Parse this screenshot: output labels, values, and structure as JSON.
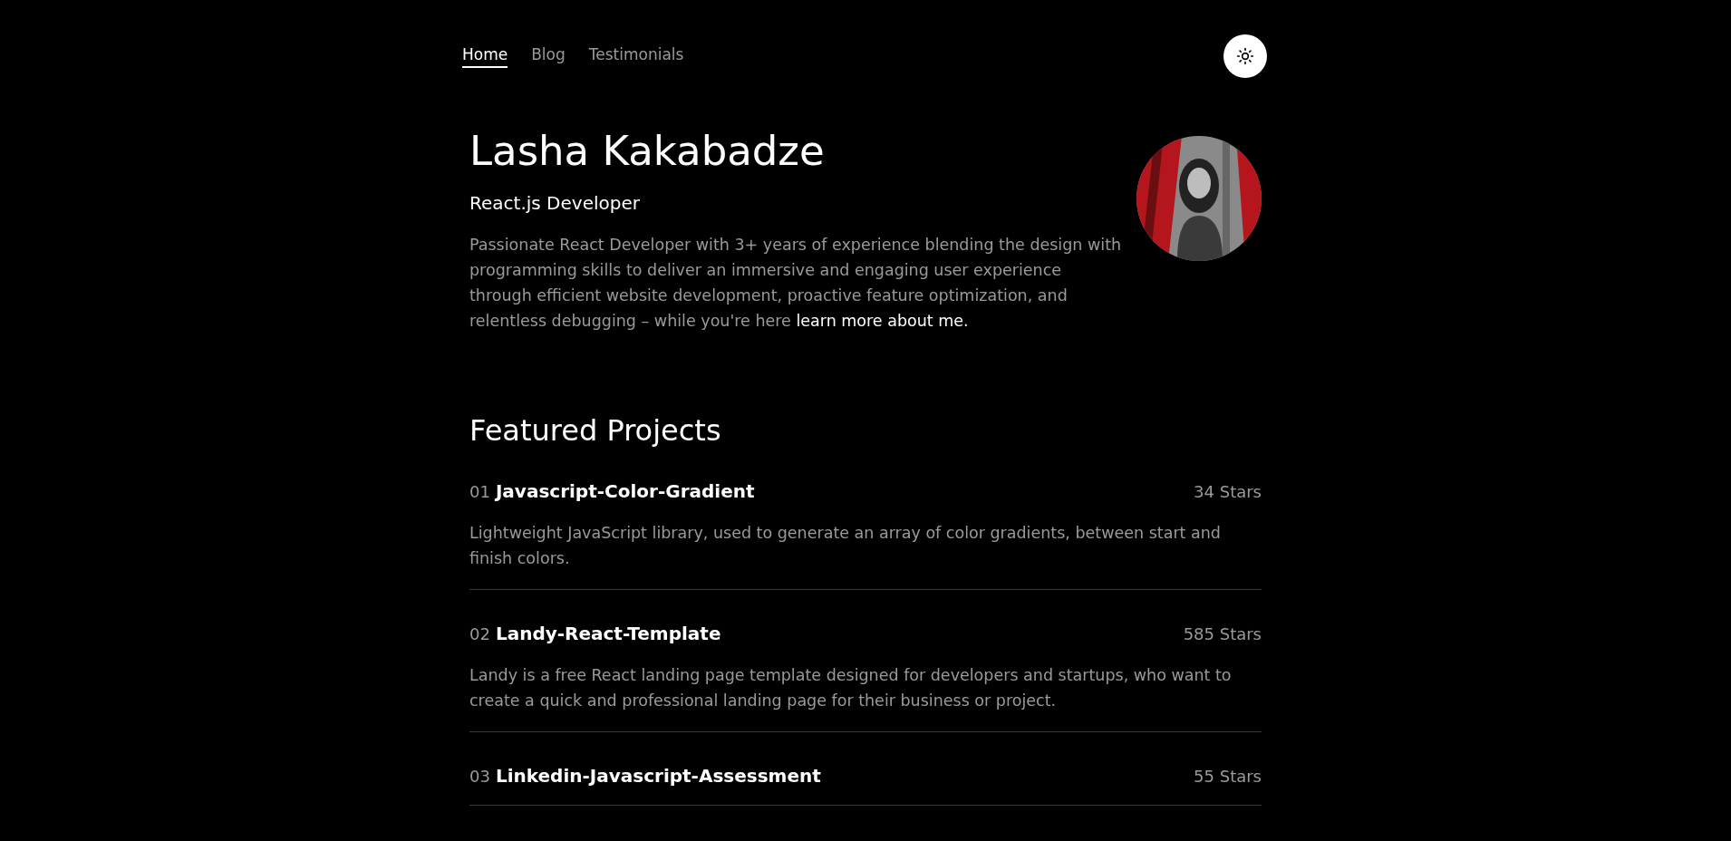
{
  "nav": {
    "links": [
      {
        "label": "Home",
        "selected": true
      },
      {
        "label": "Blog",
        "selected": false
      },
      {
        "label": "Testimonials",
        "selected": false
      }
    ]
  },
  "hero": {
    "name": "Lasha Kakabadze",
    "role": "React.js Developer",
    "bio": "Passionate React Developer with 3+ years of experience blending the design with programming skills to deliver an immersive and engaging user experience through efficient website development, proactive feature optimization, and relentless debugging –  while you're here",
    "link": "learn more about me."
  },
  "projects": {
    "title": "Featured Projects",
    "items": [
      {
        "number": "01",
        "name": "Javascript-Color-Gradient",
        "stars": "34 Stars",
        "description": "Lightweight JavaScript library, used to generate an array of color gradients, between start and finish colors."
      },
      {
        "number": "02",
        "name": "Landy-React-Template",
        "stars": "585 Stars",
        "description": "Landy is a free React landing page template designed for developers and startups, who want to create a quick and professional landing page for their business or project."
      },
      {
        "number": "03",
        "name": "Linkedin-Javascript-Assessment",
        "stars": "55 Stars"
      }
    ]
  }
}
